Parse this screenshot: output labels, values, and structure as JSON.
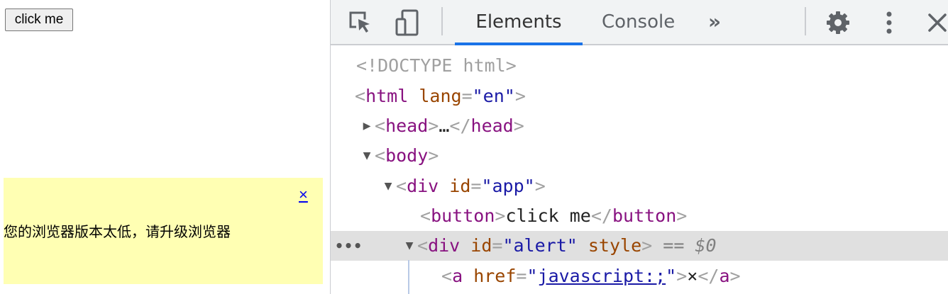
{
  "page": {
    "button_label": "click me",
    "alert": {
      "close_label": "×",
      "message": "您的浏览器版本太低，请升级浏览器",
      "background": "#ffffb3"
    }
  },
  "devtools": {
    "toolbar": {
      "inspect_icon": "inspect-element-icon",
      "device_icon": "device-toolbar-icon",
      "tabs": [
        {
          "label": "Elements",
          "active": true
        },
        {
          "label": "Console",
          "active": false
        }
      ],
      "more_tabs_label": "»",
      "settings_icon": "gear-icon",
      "menu_icon": "more-vertical-icon",
      "close_icon": "close-icon",
      "accent": "#1a73e8"
    },
    "dom": {
      "doctype": "<!DOCTYPE html>",
      "html_tag": "html",
      "html_attr": "lang",
      "html_val": "\"en\"",
      "head_tag": "head",
      "head_ellipsis": "…",
      "body_tag": "body",
      "app_tag": "div",
      "app_attr": "id",
      "app_val": "\"app\"",
      "button_tag": "button",
      "button_text": "click me",
      "alert_tag": "div",
      "alert_attr_id": "id",
      "alert_val": "\"alert\"",
      "alert_attr_style": "style",
      "selected_marker": "== $0",
      "row_dots": "•••",
      "a_tag": "a",
      "a_attr": "href",
      "a_val": "javascript:;",
      "a_text": "×"
    }
  }
}
